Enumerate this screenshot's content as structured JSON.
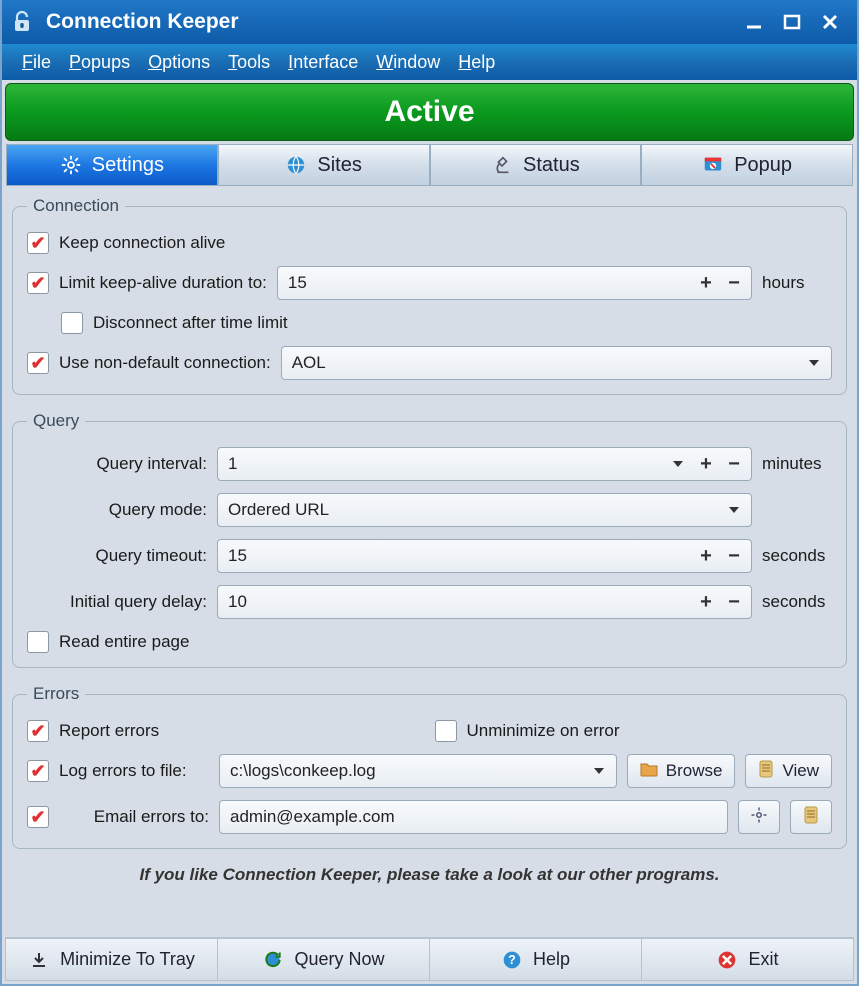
{
  "window": {
    "title": "Connection Keeper"
  },
  "menus": {
    "file": "File",
    "popups": "Popups",
    "options": "Options",
    "tools": "Tools",
    "interface": "Interface",
    "window": "Window",
    "help": "Help"
  },
  "banner": {
    "status": "Active"
  },
  "tabs": {
    "settings": "Settings",
    "sites": "Sites",
    "status": "Status",
    "popup": "Popup"
  },
  "connection": {
    "legend": "Connection",
    "keep_alive_label": "Keep connection alive",
    "limit_label": "Limit keep-alive duration to:",
    "limit_value": "15",
    "limit_unit": "hours",
    "disconnect_label": "Disconnect after time limit",
    "nondefault_label": "Use non-default connection:",
    "nondefault_value": "AOL"
  },
  "query": {
    "legend": "Query",
    "interval_label": "Query interval:",
    "interval_value": "1",
    "interval_unit": "minutes",
    "mode_label": "Query mode:",
    "mode_value": "Ordered URL",
    "timeout_label": "Query timeout:",
    "timeout_value": "15",
    "timeout_unit": "seconds",
    "initial_label": "Initial query delay:",
    "initial_value": "10",
    "initial_unit": "seconds",
    "read_entire_label": "Read entire page"
  },
  "errors": {
    "legend": "Errors",
    "report_label": "Report errors",
    "unmin_label": "Unminimize on error",
    "log_label": "Log errors to file:",
    "log_value": "c:\\logs\\conkeep.log",
    "browse_label": "Browse",
    "view_label": "View",
    "email_label": "Email errors to:",
    "email_value": "admin@example.com"
  },
  "promo": "If you like Connection Keeper, please take a look at our other programs.",
  "footer": {
    "minimize": "Minimize To Tray",
    "query_now": "Query Now",
    "help": "Help",
    "exit": "Exit"
  }
}
